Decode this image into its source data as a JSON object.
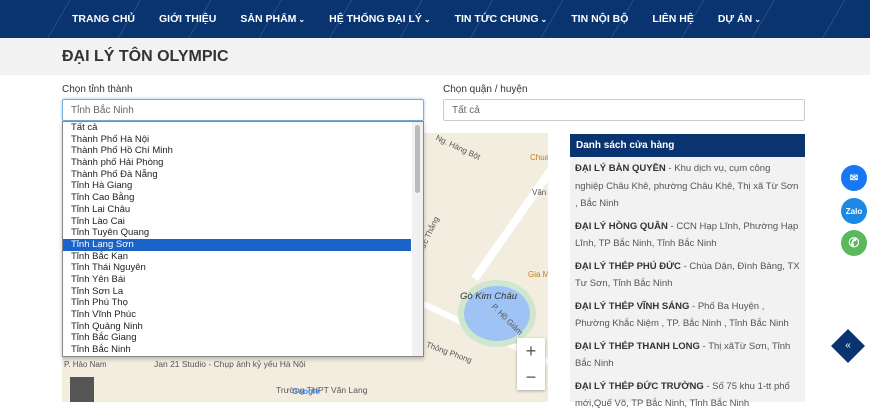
{
  "nav": {
    "items": [
      {
        "label": "TRANG CHỦ",
        "dropdown": false
      },
      {
        "label": "GIỚI THIỆU",
        "dropdown": false
      },
      {
        "label": "SẢN PHẨM",
        "dropdown": true
      },
      {
        "label": "HỆ THỐNG ĐẠI LÝ",
        "dropdown": true
      },
      {
        "label": "TIN TỨC CHUNG",
        "dropdown": true
      },
      {
        "label": "TIN NỘI BỘ",
        "dropdown": false
      },
      {
        "label": "LIÊN HỆ",
        "dropdown": false
      },
      {
        "label": "DỰ ÁN",
        "dropdown": true
      }
    ]
  },
  "page_title": "ĐẠI LÝ TÔN OLYMPIC",
  "province": {
    "label": "Chọn tỉnh thành",
    "value": "Tỉnh Bắc Ninh",
    "options": [
      "Tất cả",
      "Thành Phố Hà Nội",
      "Thành Phố Hồ Chí Minh",
      "Thành phố Hải Phòng",
      "Thành Phố Đà Nẵng",
      "Tỉnh Hà Giang",
      "Tỉnh Cao Bằng",
      "Tỉnh Lai Châu",
      "Tỉnh Lào Cai",
      "Tỉnh Tuyên Quang",
      "Tỉnh Lạng Sơn",
      "Tỉnh Bắc Kạn",
      "Tỉnh Thái Nguyên",
      "Tỉnh Yên Bái",
      "Tỉnh Sơn La",
      "Tỉnh Phú Thọ",
      "Tỉnh Vĩnh Phúc",
      "Tỉnh Quảng Ninh",
      "Tỉnh Bắc Giang",
      "Tỉnh Bắc Ninh"
    ],
    "highlighted": "Tỉnh Lạng Sơn"
  },
  "district": {
    "label": "Chọn quận / huyện",
    "value": "Tất cả"
  },
  "map": {
    "labels": [
      "Ng. Hàng Bột",
      "Chua",
      "Văn Quốc",
      "Tôn Đức Thắng",
      "Gia Món ăn",
      "Gò Kim Châu",
      "P. Hồ Giám",
      "Thông Phong",
      "Jan 21 Studio - Chụp ảnh kỷ yếu Hà Nội",
      "P. Hào Nam",
      "Trường THPT Văn Lang",
      "Google"
    ],
    "zoom_in": "+",
    "zoom_out": "−"
  },
  "stores": {
    "title": "Danh sách cửa hàng",
    "items": [
      {
        "name": "ĐẠI LÝ BÀN QUYỀN",
        "address": " - Khu dịch vụ, cụm công nghiệp Châu Khê, phường Châu Khê, Thị xã Từ Sơn , Bắc Ninh"
      },
      {
        "name": "ĐẠI LÝ HỒNG QUÂN",
        "address": " - CCN Hạp Lĩnh, Phường Hạp Lĩnh, TP Bắc Ninh, Tỉnh Bắc Ninh"
      },
      {
        "name": "ĐẠI LÝ THÉP PHÚ ĐỨC",
        "address": " - Chùa Dận, Đình Bảng, TX Tư Sơn, Tỉnh Bắc Ninh"
      },
      {
        "name": "ĐẠI LÝ THÉP VĨNH SÁNG",
        "address": " - Phố Ba Huyện , Phường Khắc Niệm , TP. Bắc Ninh , Tỉnh Bắc Ninh"
      },
      {
        "name": "ĐẠI LÝ THÉP THANH LONG",
        "address": " - Thị xãTừ Sơn, Tỉnh Bắc Ninh"
      },
      {
        "name": "ĐẠI LÝ THÉP ĐỨC TRƯỜNG",
        "address": " - Số 75 khu 1-tt phố mới,Quế Võ, TP Bắc Ninh, Tỉnh Bắc Ninh"
      }
    ]
  },
  "floating": {
    "zalo": "Zalo",
    "back_to_top": "«"
  },
  "colors": {
    "brand": "#0a3470",
    "highlight": "#1a63c9",
    "messenger": "#1877f2",
    "zalo": "#1e88e5",
    "phone": "#5cb85c"
  }
}
